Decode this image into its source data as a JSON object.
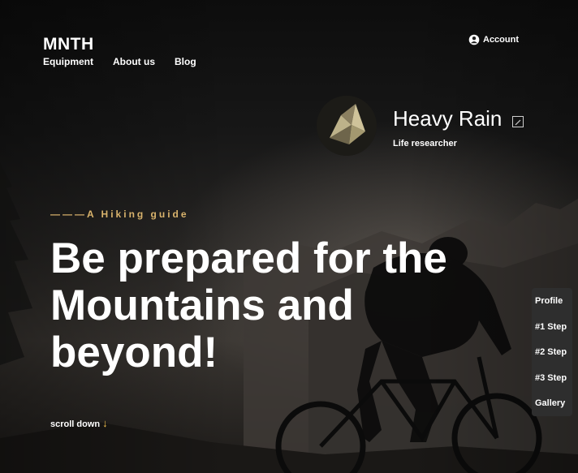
{
  "header": {
    "logo": "MNTH",
    "nav": [
      {
        "label": "Equipment"
      },
      {
        "label": "About us"
      },
      {
        "label": "Blog"
      }
    ],
    "account_label": "Account"
  },
  "profile": {
    "name": "Heavy Rain",
    "role": "Life researcher"
  },
  "hero": {
    "eyebrow": "———A Hiking guide",
    "headline": "Be prepared for the Mountains and beyond!",
    "scroll_label": "scroll down",
    "scroll_arrow": "↓"
  },
  "step_nav": [
    {
      "label": "Profile"
    },
    {
      "label": "#1 Step"
    },
    {
      "label": "#2 Step"
    },
    {
      "label": "#3 Step"
    },
    {
      "label": "Gallery"
    }
  ],
  "colors": {
    "accent": "#d9b36c",
    "arrow": "#f2c14e",
    "panel": "#2e2e2e"
  }
}
